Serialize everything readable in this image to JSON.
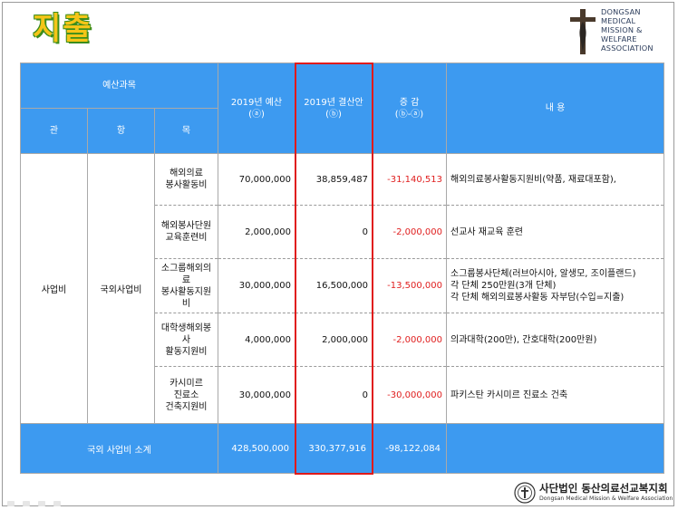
{
  "title": "지출",
  "logo": {
    "lines": [
      "DONGSAN",
      "MEDICAL",
      "MISSION &",
      "WELFARE",
      "ASSOCIATION"
    ]
  },
  "table": {
    "headers": {
      "budget_subject": "예산과목",
      "gwan": "관",
      "hang": "항",
      "mok": "목",
      "budget_2019": "2019년 예산",
      "budget_2019_mark": "(ⓐ)",
      "settlement_2019": "2019년 결산안",
      "settlement_2019_mark": "(ⓑ)",
      "change": "증 감",
      "change_mark": "(ⓑ-ⓐ)",
      "content": "내 용"
    },
    "gwan": "사업비",
    "hang": "국외사업비",
    "rows": [
      {
        "item_lines": [
          "해외의료",
          "봉사활동비"
        ],
        "budget": "70,000,000",
        "settlement": "38,859,487",
        "change": "-31,140,513",
        "content_lines": [
          "해외의료봉사활동지원비(약품, 재료대포함),"
        ]
      },
      {
        "item_lines": [
          "해외봉사단원",
          "교육훈련비"
        ],
        "budget": "2,000,000",
        "settlement": "0",
        "change": "-2,000,000",
        "content_lines": [
          "선교사 재교육 훈련"
        ]
      },
      {
        "item_lines": [
          "소그룹해외의료",
          "봉사활동지원비"
        ],
        "budget": "30,000,000",
        "settlement": "16,500,000",
        "change": "-13,500,000",
        "content_lines": [
          "소그룹봉사단체(러브아시아, 알생모, 조이플랜드)",
          "각 단체 250만원(3개 단체)",
          "각 단체 해외의료봉사활동 자부담(수입=지출)"
        ]
      },
      {
        "item_lines": [
          "대학생해외봉사",
          "활동지원비"
        ],
        "budget": "4,000,000",
        "settlement": "2,000,000",
        "change": "-2,000,000",
        "content_lines": [
          "의과대학(200만), 간호대학(200만원)"
        ]
      },
      {
        "item_lines": [
          "카시미르",
          "진료소",
          "건축지원비"
        ],
        "budget": "30,000,000",
        "settlement": "0",
        "change": "-30,000,000",
        "content_lines": [
          "파키스탄 카시미르 진료소 건축"
        ]
      }
    ],
    "total": {
      "label": "국외 사업비  소계",
      "budget": "428,500,000",
      "settlement": "330,377,916",
      "change": "-98,122,084",
      "content": ""
    }
  },
  "footer": {
    "org_name": "사단법인 동산의료선교복지회",
    "org_name_en": "Dongsan Medical Mission & Welfare Association"
  },
  "colors": {
    "header_blue": "#3d9af0",
    "highlight_red": "#e01a1a",
    "negative_red": "#e02020",
    "title_yellow": "#f5c518",
    "title_green": "#3b8d1c"
  }
}
